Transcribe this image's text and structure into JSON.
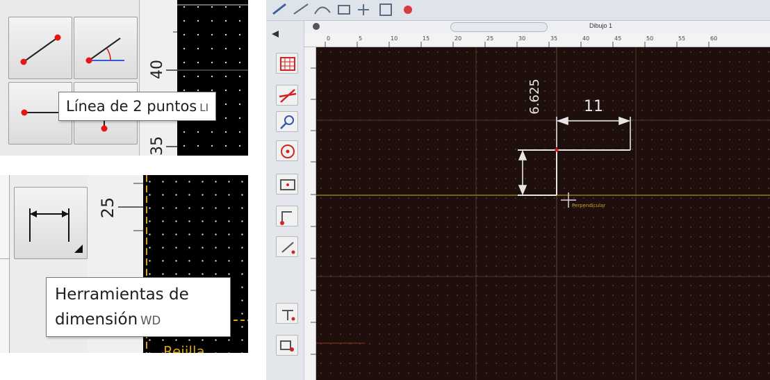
{
  "line_tools_panel": {
    "ruler_numbers": [
      "40",
      "35"
    ],
    "tooltip": {
      "label": "Línea de 2 puntos",
      "shortcut": "LI"
    }
  },
  "dimension_panel": {
    "ruler_number": "25",
    "tooltip": {
      "line1": "Herramientas de",
      "line2": "dimensión",
      "shortcut": "WD"
    },
    "status_text": "Rejilla"
  },
  "cad_view": {
    "tab_label": "Dibujo 1",
    "horizontal_ruler_ticks": [
      "0",
      "5",
      "10",
      "15",
      "20",
      "25",
      "30",
      "35",
      "40",
      "45",
      "50",
      "55",
      "60"
    ],
    "dimension_vertical": "6.625",
    "dimension_horizontal": "11",
    "cursor_label": "Perpendicular"
  },
  "colors": {
    "accent_point": "#e81414",
    "angle_blue": "#2f5fd8",
    "canvas_black": "#000000",
    "cad_canvas": "#1e0f0c",
    "grid_yellow": "#d6a11a",
    "dimension_white": "#e6e6e6"
  }
}
